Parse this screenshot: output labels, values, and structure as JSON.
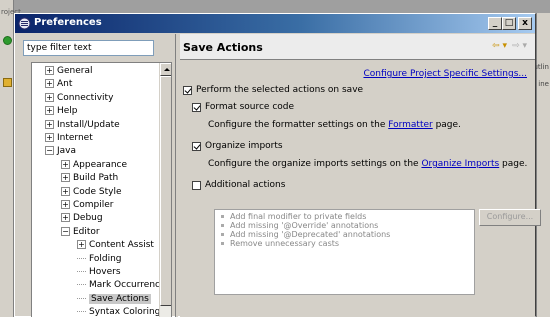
{
  "window": {
    "title": "Preferences",
    "minimize": "_",
    "maximize": "□",
    "close": "x"
  },
  "background": {
    "left_partial": "roject",
    "right_line1": "utlin",
    "right_line2": "ine"
  },
  "filter": {
    "value": "type filter text"
  },
  "tree": [
    {
      "label": "General",
      "level": 0,
      "kind": "collapsed"
    },
    {
      "label": "Ant",
      "level": 0,
      "kind": "collapsed"
    },
    {
      "label": "Connectivity",
      "level": 0,
      "kind": "collapsed"
    },
    {
      "label": "Help",
      "level": 0,
      "kind": "collapsed"
    },
    {
      "label": "Install/Update",
      "level": 0,
      "kind": "collapsed"
    },
    {
      "label": "Internet",
      "level": 0,
      "kind": "collapsed"
    },
    {
      "label": "Java",
      "level": 0,
      "kind": "expanded"
    },
    {
      "label": "Appearance",
      "level": 1,
      "kind": "collapsed"
    },
    {
      "label": "Build Path",
      "level": 1,
      "kind": "collapsed"
    },
    {
      "label": "Code Style",
      "level": 1,
      "kind": "collapsed"
    },
    {
      "label": "Compiler",
      "level": 1,
      "kind": "collapsed"
    },
    {
      "label": "Debug",
      "level": 1,
      "kind": "collapsed"
    },
    {
      "label": "Editor",
      "level": 1,
      "kind": "expanded"
    },
    {
      "label": "Content Assist",
      "level": 2,
      "kind": "collapsed"
    },
    {
      "label": "Folding",
      "level": 2,
      "kind": "leaf"
    },
    {
      "label": "Hovers",
      "level": 2,
      "kind": "leaf"
    },
    {
      "label": "Mark Occurrences",
      "level": 2,
      "kind": "leaf"
    },
    {
      "label": "Save Actions",
      "level": 2,
      "kind": "leaf",
      "selected": true
    },
    {
      "label": "Syntax Coloring",
      "level": 2,
      "kind": "leaf"
    }
  ],
  "page": {
    "title": "Save Actions",
    "nav_back": "⇦ ▾",
    "nav_forward": "⇨ ▾",
    "configure_link": "Configure Project Specific Settings...",
    "perform": {
      "label": "Perform the selected actions on save",
      "checked": true
    },
    "format": {
      "label": "Format source code",
      "checked": true
    },
    "format_desc_pre": "Configure the formatter settings on the ",
    "format_desc_link": "Formatter",
    "format_desc_post": " page.",
    "organize": {
      "label": "Organize imports",
      "checked": true
    },
    "organize_desc_pre": "Configure the organize imports settings on the ",
    "organize_desc_link": "Organize Imports",
    "organize_desc_post": " page.",
    "additional": {
      "label": "Additional actions",
      "checked": false
    },
    "additional_items": [
      "Add final modifier to private fields",
      "Add missing '@Override' annotations",
      "Add missing '@Deprecated' annotations",
      "Remove unnecessary casts"
    ],
    "configure_button": "Configure..."
  }
}
